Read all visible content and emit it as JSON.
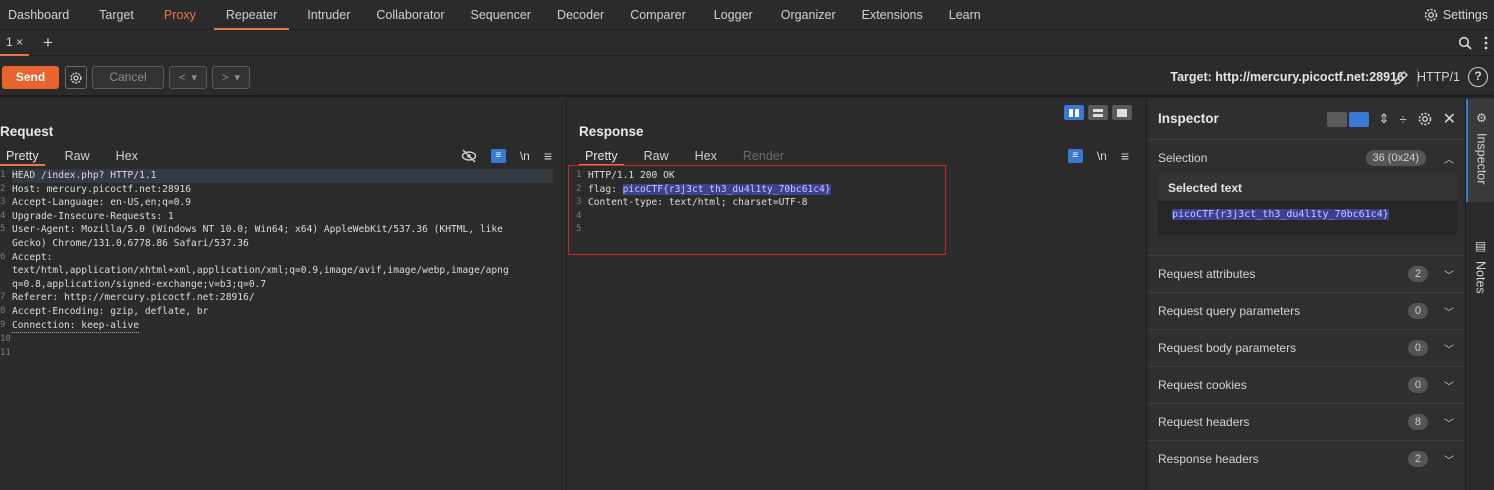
{
  "topnav": {
    "tabs": [
      "Dashboard",
      "Target",
      "Proxy",
      "Repeater",
      "Intruder",
      "Collaborator",
      "Sequencer",
      "Decoder",
      "Comparer",
      "Logger",
      "Organizer",
      "Extensions",
      "Learn"
    ],
    "settings_label": "Settings"
  },
  "repeater_tab": {
    "label": "1 ×",
    "add": "+"
  },
  "toolbar": {
    "send_label": "Send",
    "cancel_label": "Cancel",
    "target_label": "Target: http://mercury.picoctf.net:28916",
    "http_version": "HTTP/1",
    "help": "?"
  },
  "request": {
    "title": "Request",
    "tabs": [
      "Pretty",
      "Raw",
      "Hex"
    ],
    "newline_symbol": "\\n",
    "lines": [
      {
        "n": "1",
        "t": "HEAD /index.php? HTTP/1.1"
      },
      {
        "n": "2",
        "t": "Host: mercury.picoctf.net:28916"
      },
      {
        "n": "3",
        "t": "Accept-Language: en-US,en;q=0.9"
      },
      {
        "n": "4",
        "t": "Upgrade-Insecure-Requests: 1"
      },
      {
        "n": "5",
        "t": "User-Agent: Mozilla/5.0 (Windows NT 10.0; Win64; x64) AppleWebKit/537.36 (KHTML, like"
      },
      {
        "n": "",
        "t": "Gecko) Chrome/131.0.6778.86 Safari/537.36"
      },
      {
        "n": "6",
        "t": "Accept:"
      },
      {
        "n": "",
        "t": "text/html,application/xhtml+xml,application/xml;q=0.9,image/avif,image/webp,image/apng"
      },
      {
        "n": "",
        "t": "q=0.8,application/signed-exchange;v=b3;q=0.7"
      },
      {
        "n": "7",
        "t": "Referer: http://mercury.picoctf.net:28916/"
      },
      {
        "n": "8",
        "t": "Accept-Encoding: gzip, deflate, br"
      },
      {
        "n": "9",
        "t": "Connection: keep-alive"
      },
      {
        "n": "10",
        "t": ""
      },
      {
        "n": "11",
        "t": ""
      }
    ]
  },
  "response": {
    "title": "Response",
    "tabs": [
      "Pretty",
      "Raw",
      "Hex",
      "Render"
    ],
    "newline_symbol": "\\n",
    "line1": "HTTP/1.1 200 OK",
    "flag_key": "flag: ",
    "flag_value": "picoCTF{r3j3ct_th3_du4l1ty_70bc61c4}",
    "line3": "Content-type: text/html; charset=UTF-8",
    "line_numbers": [
      "1",
      "2",
      "3",
      "4",
      "5"
    ]
  },
  "inspector": {
    "title": "Inspector",
    "selection_label": "Selection",
    "selection_badge": "36 (0x24)",
    "selected_text_label": "Selected text",
    "selected_text": "picoCTF{r3j3ct_th3_du4l1ty_70bc61c4}",
    "rows": [
      {
        "label": "Request attributes",
        "count": "2"
      },
      {
        "label": "Request query parameters",
        "count": "0"
      },
      {
        "label": "Request body parameters",
        "count": "0"
      },
      {
        "label": "Request cookies",
        "count": "0"
      },
      {
        "label": "Request headers",
        "count": "8"
      },
      {
        "label": "Response headers",
        "count": "2"
      }
    ]
  },
  "sidebar": {
    "inspector_label": "Inspector",
    "notes_label": "Notes"
  },
  "colors": {
    "accent": "#e8632d",
    "selection": "#3a78d4",
    "highlight_box": "#c62828"
  }
}
